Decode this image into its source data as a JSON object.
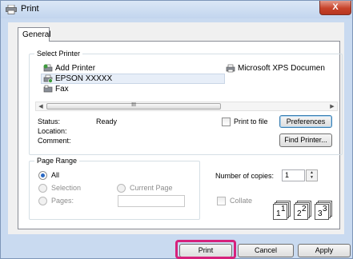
{
  "window": {
    "title": "Print",
    "close_label": "X"
  },
  "tabs": [
    {
      "label": "General"
    }
  ],
  "select_printer": {
    "legend": "Select Printer",
    "printers": [
      {
        "name": "Add Printer",
        "icon": "add-printer-icon"
      },
      {
        "name": "Microsoft XPS Documen",
        "icon": "printer-icon"
      },
      {
        "name": "EPSON XXXXX",
        "icon": "printer-icon",
        "selected": true
      },
      {
        "name": "Fax",
        "icon": "fax-icon"
      }
    ],
    "scroll_thumb_glyph": "III",
    "status_label": "Status:",
    "status_value": "Ready",
    "location_label": "Location:",
    "comment_label": "Comment:",
    "print_to_file_label": "Print to file",
    "print_to_file_checked": false,
    "preferences_label": "Preferences",
    "find_printer_label": "Find Printer..."
  },
  "page_range": {
    "legend": "Page Range",
    "options": [
      {
        "label": "All",
        "selected": true,
        "enabled": true
      },
      {
        "label": "Selection",
        "selected": false,
        "enabled": false
      },
      {
        "label": "Current Page",
        "selected": false,
        "enabled": false
      },
      {
        "label": "Pages:",
        "selected": false,
        "enabled": false
      }
    ],
    "pages_value": ""
  },
  "copies": {
    "label": "Number of copies:",
    "value": "1",
    "collate_label": "Collate",
    "collate_checked": false,
    "collate_pages": [
      "1",
      "1",
      "2",
      "2",
      "3",
      "3"
    ]
  },
  "buttons": {
    "print": "Print",
    "cancel": "Cancel",
    "apply": "Apply"
  },
  "colors": {
    "highlight": "#d6217c",
    "selection_dot": "#2a69c4"
  }
}
